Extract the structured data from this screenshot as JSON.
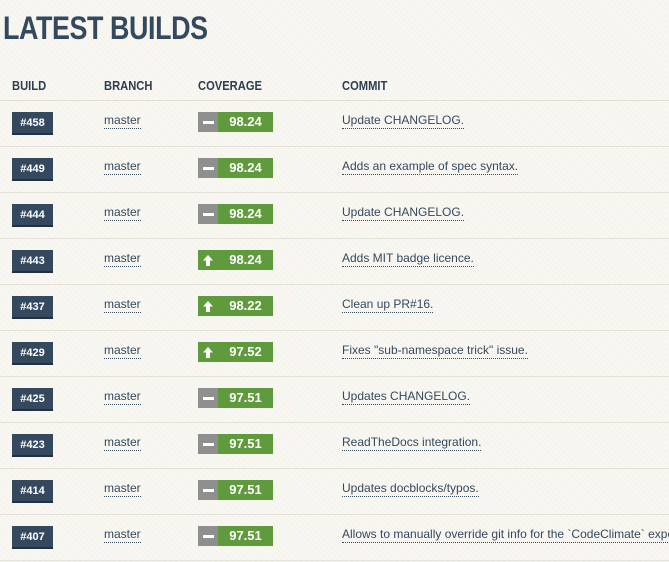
{
  "page": {
    "title": "LATEST BUILDS"
  },
  "table": {
    "headers": {
      "build": "BUILD",
      "branch": "BRANCH",
      "coverage": "COVERAGE",
      "commit": "COMMIT"
    },
    "rows": [
      {
        "build": "#458",
        "branch": "master",
        "trend": "same",
        "coverage": "98.24",
        "commit": "Update CHANGELOG."
      },
      {
        "build": "#449",
        "branch": "master",
        "trend": "same",
        "coverage": "98.24",
        "commit": "Adds an example of spec syntax."
      },
      {
        "build": "#444",
        "branch": "master",
        "trend": "same",
        "coverage": "98.24",
        "commit": "Update CHANGELOG."
      },
      {
        "build": "#443",
        "branch": "master",
        "trend": "up",
        "coverage": "98.24",
        "commit": "Adds MIT badge licence."
      },
      {
        "build": "#437",
        "branch": "master",
        "trend": "up",
        "coverage": "98.22",
        "commit": "Clean up PR#16."
      },
      {
        "build": "#429",
        "branch": "master",
        "trend": "up",
        "coverage": "97.52",
        "commit": "Fixes \"sub-namespace trick\" issue."
      },
      {
        "build": "#425",
        "branch": "master",
        "trend": "same",
        "coverage": "97.51",
        "commit": "Updates CHANGELOG."
      },
      {
        "build": "#423",
        "branch": "master",
        "trend": "same",
        "coverage": "97.51",
        "commit": "ReadTheDocs integration."
      },
      {
        "build": "#414",
        "branch": "master",
        "trend": "same",
        "coverage": "97.51",
        "commit": "Updates docblocks/typos."
      },
      {
        "build": "#407",
        "branch": "master",
        "trend": "same",
        "coverage": "97.51",
        "commit": "Allows to manually override git info for the `CodeClimate` exporte"
      }
    ]
  },
  "icons": {
    "same": "dash-icon",
    "up": "arrow-up-icon"
  },
  "colors": {
    "build_badge": "#34495e",
    "coverage_green": "#5f9a3c",
    "coverage_same": "#8f8f8f",
    "text": "#34495e",
    "background": "#f8f7f2"
  }
}
